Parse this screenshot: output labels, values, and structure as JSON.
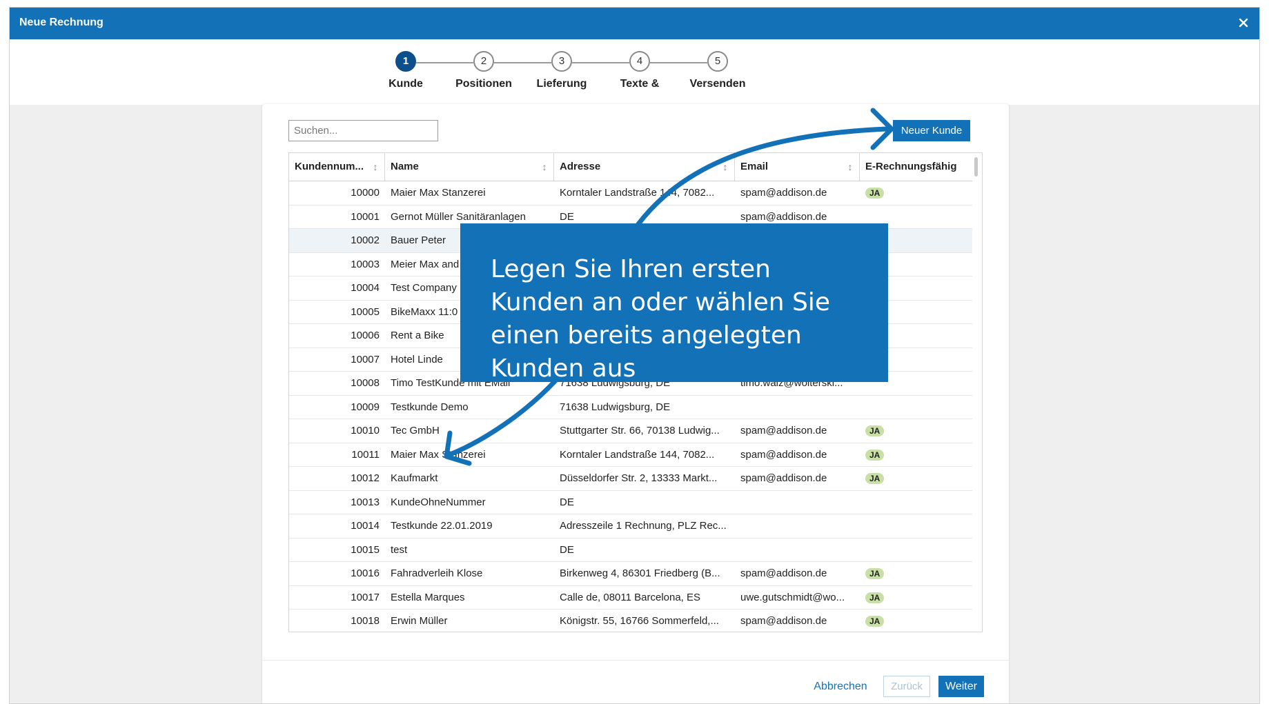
{
  "dialog": {
    "title": "Neue Rechnung",
    "close_icon": "close-icon"
  },
  "stepper": {
    "steps": [
      {
        "number": "1",
        "label": "Kunde",
        "active": true
      },
      {
        "number": "2",
        "label": "Positionen",
        "active": false
      },
      {
        "number": "3",
        "label": "Lieferung",
        "active": false
      },
      {
        "number": "4",
        "label": "Texte &",
        "active": false
      },
      {
        "number": "5",
        "label": "Versenden",
        "active": false
      }
    ]
  },
  "search": {
    "placeholder": "Suchen...",
    "value": ""
  },
  "toolbar": {
    "new_customer_label": "Neuer Kunde"
  },
  "table": {
    "columns": [
      "Kundennum...",
      "Name",
      "Adresse",
      "Email",
      "E-Rechnungsfähig"
    ],
    "rows": [
      {
        "id": "10000",
        "name": "Maier Max Stanzerei",
        "address": "Korntaler Landstraße 144, 7082...",
        "email": "spam@addison.de",
        "einvoice": "JA"
      },
      {
        "id": "10001",
        "name": "Gernot Müller Sanitäranlagen",
        "address": "DE",
        "email": "spam@addison.de",
        "einvoice": ""
      },
      {
        "id": "10002",
        "name": "Bauer Peter",
        "address": "",
        "email": "",
        "einvoice": ""
      },
      {
        "id": "10003",
        "name": "Meier Max and",
        "address": "",
        "email": "",
        "einvoice": ""
      },
      {
        "id": "10004",
        "name": "Test Company",
        "address": "",
        "email": "",
        "einvoice": ""
      },
      {
        "id": "10005",
        "name": "BikeMaxx 11:0",
        "address": "",
        "email": "",
        "einvoice": ""
      },
      {
        "id": "10006",
        "name": "Rent a Bike",
        "address": "",
        "email": "",
        "einvoice": ""
      },
      {
        "id": "10007",
        "name": "Hotel Linde",
        "address": "",
        "email": "",
        "einvoice": ""
      },
      {
        "id": "10008",
        "name": "Timo TestKunde mit EMail",
        "address": "71638 Ludwigsburg, DE",
        "email": "timo.walz@wolterskl...",
        "einvoice": ""
      },
      {
        "id": "10009",
        "name": "Testkunde Demo",
        "address": "71638 Ludwigsburg, DE",
        "email": "",
        "einvoice": ""
      },
      {
        "id": "10010",
        "name": "Tec GmbH",
        "address": "Stuttgarter Str. 66, 70138 Ludwig...",
        "email": "spam@addison.de",
        "einvoice": "JA"
      },
      {
        "id": "10011",
        "name": "Maier Max Stanzerei",
        "address": "Korntaler Landstraße 144, 7082...",
        "email": "spam@addison.de",
        "einvoice": "JA"
      },
      {
        "id": "10012",
        "name": "Kaufmarkt",
        "address": "Düsseldorfer Str. 2, 13333 Markt...",
        "email": "spam@addison.de",
        "einvoice": "JA"
      },
      {
        "id": "10013",
        "name": "KundeOhneNummer",
        "address": "DE",
        "email": "",
        "einvoice": ""
      },
      {
        "id": "10014",
        "name": "Testkunde 22.01.2019",
        "address": "Adresszeile 1 Rechnung, PLZ Rec...",
        "email": "",
        "einvoice": ""
      },
      {
        "id": "10015",
        "name": "test",
        "address": "DE",
        "email": "",
        "einvoice": ""
      },
      {
        "id": "10016",
        "name": "Fahradverleih Klose",
        "address": "Birkenweg 4, 86301 Friedberg (B...",
        "email": "spam@addison.de",
        "einvoice": "JA"
      },
      {
        "id": "10017",
        "name": "Estella Marques",
        "address": "Calle de, 08011 Barcelona, ES",
        "email": "uwe.gutschmidt@wo...",
        "einvoice": "JA"
      },
      {
        "id": "10018",
        "name": "Erwin Müller",
        "address": "Königstr. 55, 16766 Sommerfeld,...",
        "email": "spam@addison.de",
        "einvoice": "JA"
      }
    ]
  },
  "footer": {
    "cancel_label": "Abbrechen",
    "back_label": "Zurück",
    "next_label": "Weiter"
  },
  "callout": {
    "text": "Legen Sie Ihren ersten Kunden an oder wählen Sie einen bereits angelegten Kunden aus"
  },
  "colors": {
    "accent": "#1371b8",
    "active_step": "#0d4f8a",
    "badge": "#c8dfa6"
  }
}
